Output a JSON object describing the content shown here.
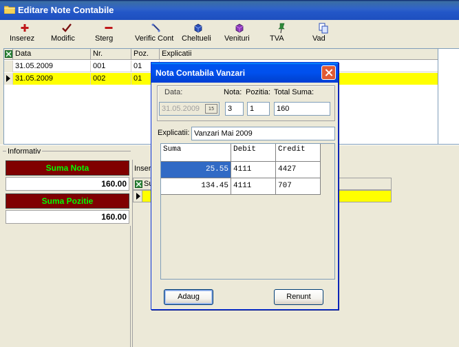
{
  "window": {
    "title": "Editare Note Contabile"
  },
  "toolbar": {
    "items": [
      {
        "label": "Inserez"
      },
      {
        "label": "Modific"
      },
      {
        "label": "Sterg"
      },
      {
        "label": "Verific Cont"
      },
      {
        "label": "Cheltueli"
      },
      {
        "label": "Venituri"
      },
      {
        "label": "TVA"
      },
      {
        "label": "Vad"
      }
    ]
  },
  "main_grid": {
    "columns": [
      "Data",
      "Nr.",
      "Poz.",
      "Explicatii"
    ],
    "rows": [
      {
        "data": "31.05.2009",
        "nr": "001",
        "poz": "01",
        "expl": ""
      },
      {
        "data": "31.05.2009",
        "nr": "002",
        "poz": "01",
        "expl": ""
      }
    ]
  },
  "info_panel": {
    "legend": "Informativ",
    "suma_nota_label": "Suma Nota",
    "suma_nota_value": "160.00",
    "suma_pozitie_label": "Suma Pozitie",
    "suma_pozitie_value": "160.00"
  },
  "lower_grid": {
    "toolbar_partial": "Insere",
    "column_partial": "Su"
  },
  "dialog": {
    "title": "Nota Contabila Vanzari",
    "data_label": "Data:",
    "data_value": "31.05.2009",
    "calendar_label": "15",
    "nota_label": "Nota:",
    "nota_value": "3",
    "pozitie_label": "Pozitia:",
    "pozitie_value": "1",
    "total_label": "Total Suma:",
    "total_value": "160",
    "explicatii_label": "Explicatii:",
    "explicatii_value": "Vanzari Mai        2009",
    "grid": {
      "columns": [
        "Suma",
        "Debit",
        "Credit"
      ],
      "rows": [
        {
          "suma": "25.55",
          "debit": "4111",
          "credit": "4427"
        },
        {
          "suma": "134.45",
          "debit": "4111",
          "credit": "707"
        }
      ]
    },
    "add_button": "Adaug",
    "cancel_button": "Renunt"
  }
}
